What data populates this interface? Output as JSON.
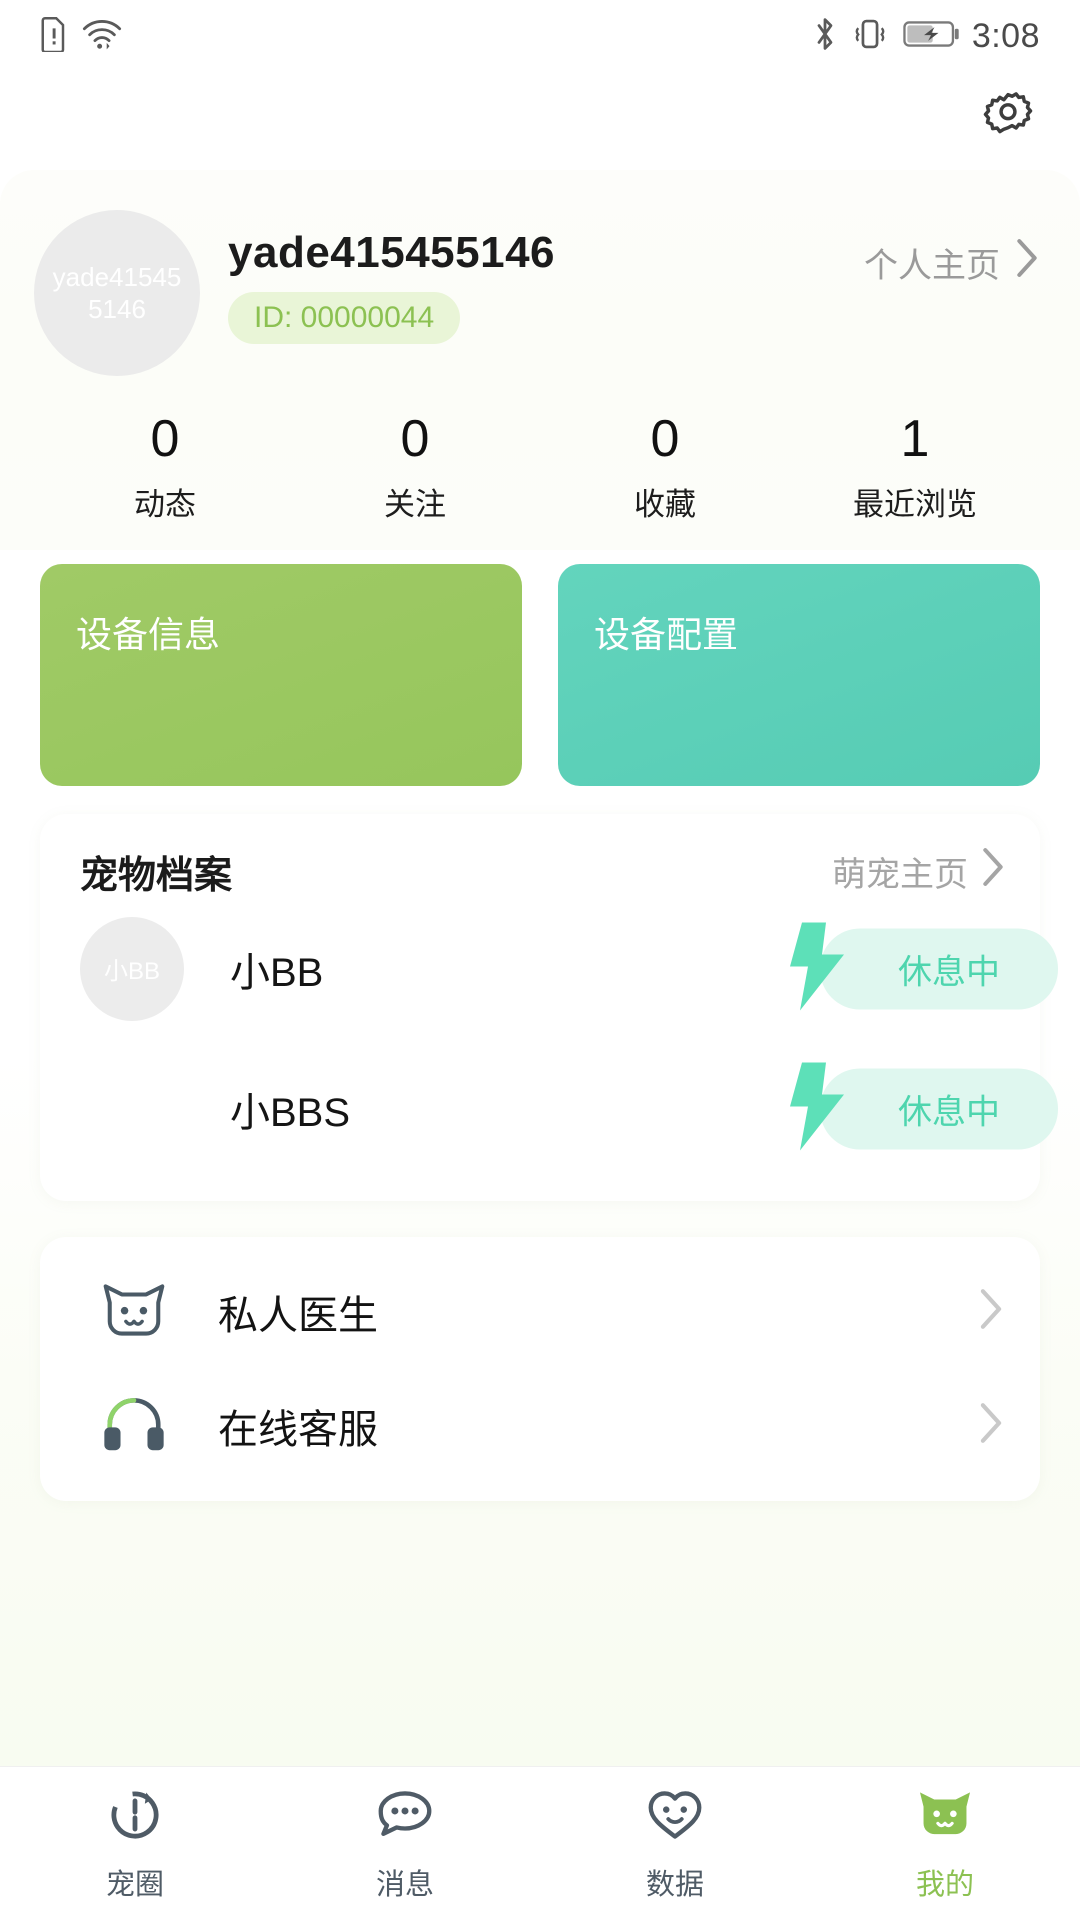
{
  "status_bar": {
    "time": "3:08",
    "left_icons": [
      "sim-alert-icon",
      "wifi-icon"
    ],
    "right_icons": [
      "bluetooth-icon",
      "vibrate-icon",
      "battery-charging-icon"
    ]
  },
  "header": {
    "settings_icon": "gear-icon"
  },
  "profile": {
    "avatar_text": "yade415455146",
    "username": "yade415455146",
    "id_badge": "ID: 00000044",
    "home_link": "个人主页",
    "home_chevron": "chevron-right-icon",
    "accent_green": "#8cc152",
    "badge_bg": "#e9f5d7"
  },
  "stats": [
    {
      "value": "0",
      "label": "动态"
    },
    {
      "value": "0",
      "label": "关注"
    },
    {
      "value": "0",
      "label": "收藏"
    },
    {
      "value": "1",
      "label": "最近浏览"
    }
  ],
  "device_tiles": [
    {
      "label": "设备信息",
      "color": "#9ac861"
    },
    {
      "label": "设备配置",
      "color": "#5ccfb8"
    }
  ],
  "pets": {
    "title": "宠物档案",
    "link": "萌宠主页",
    "link_chevron": "chevron-right-icon",
    "status_color": "#4ed5ae",
    "status_bg": "#dff7ef",
    "items": [
      {
        "avatar_text": "小BB",
        "name": "小BB",
        "status": "休息中",
        "status_icon": "lightning-bolt-icon"
      },
      {
        "avatar_text": "",
        "name": "小BBS",
        "status": "休息中",
        "status_icon": "lightning-bolt-icon"
      }
    ]
  },
  "services": [
    {
      "label": "私人医生",
      "icon": "cat-face-icon",
      "chevron": "chevron-right-icon"
    },
    {
      "label": "在线客服",
      "icon": "headset-icon",
      "chevron": "chevron-right-icon"
    }
  ],
  "bottom_nav": {
    "active_color": "#8cc152",
    "inactive_color": "#4f5b66",
    "items": [
      {
        "label": "宠圈",
        "icon": "refresh-circle-icon",
        "active": false
      },
      {
        "label": "消息",
        "icon": "chat-bubble-icon",
        "active": false
      },
      {
        "label": "数据",
        "icon": "heart-face-icon",
        "active": false
      },
      {
        "label": "我的",
        "icon": "cat-face-filled-icon",
        "active": true
      }
    ]
  }
}
